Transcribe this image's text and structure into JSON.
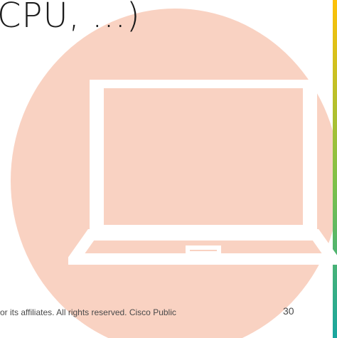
{
  "slide": {
    "heading": "CPU, ...)",
    "footer_text": "or its affiliates. All rights reserved.  Cisco Public",
    "page_number": "30"
  },
  "icons": {
    "laptop": "laptop-icon"
  },
  "colors": {
    "circle": "#f9d2c2",
    "laptop_outline": "#ffffff",
    "edge_gradient_top": "#ffc107",
    "edge_gradient_mid": "#7cc04a",
    "edge_gradient_bottom": "#18a6a0"
  }
}
